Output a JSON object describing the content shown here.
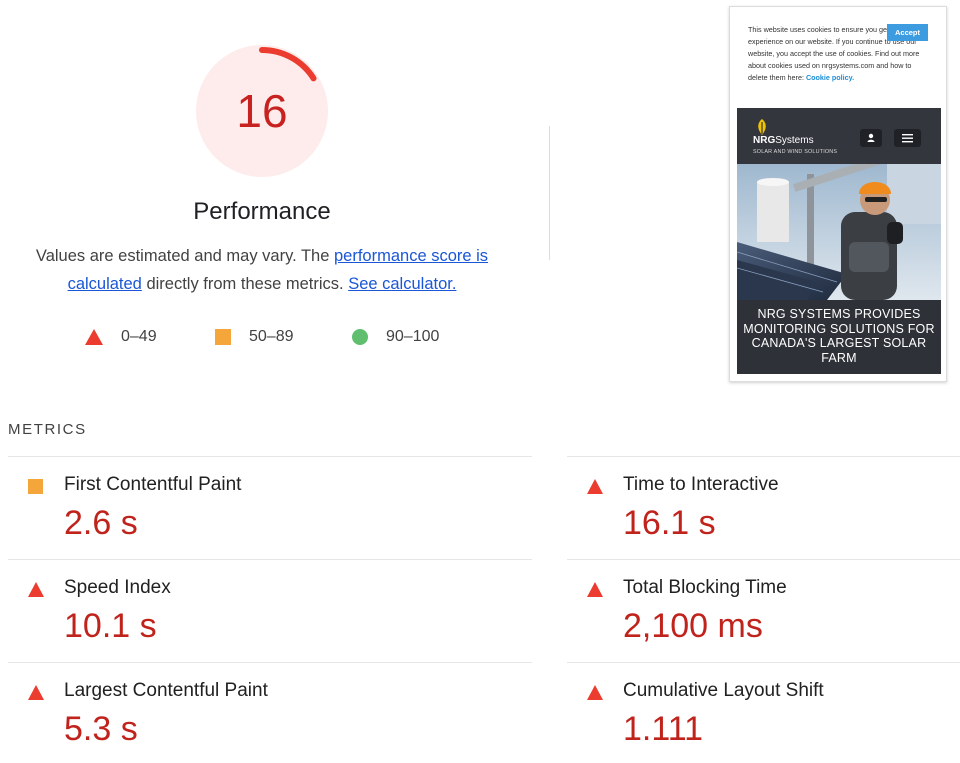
{
  "performance": {
    "score": "16",
    "score_fraction": 0.16,
    "title": "Performance",
    "desc_prefix": "Values are estimated and may vary. The ",
    "link_score": "performance score is calculated",
    "desc_middle": " directly from these metrics. ",
    "link_calculator": "See calculator.",
    "legend": [
      {
        "range": "0–49",
        "icon": "triangle-icon"
      },
      {
        "range": "50–89",
        "icon": "square-icon"
      },
      {
        "range": "90–100",
        "icon": "circle-icon"
      }
    ]
  },
  "screenshot": {
    "cookie_text": "This website uses cookies to ensure you get the best experience on our website. If you continue to use our website, you accept the use of cookies. Find out more about cookies used on nrgsystems.com and how to delete them here: ",
    "cookie_link": "Cookie policy.",
    "accept_label": "Accept",
    "logo_bold": "NRG",
    "logo_rest": "Systems",
    "logo_sub": "SOLAR AND WIND SOLUTIONS",
    "headline": "NRG SYSTEMS PROVIDES MONITORING SOLUTIONS FOR CANADA'S LARGEST SOLAR FARM"
  },
  "metrics": {
    "heading": "METRICS",
    "items": [
      {
        "name": "First Contentful Paint",
        "value": "2.6 s",
        "rating": "average",
        "icon": "square-icon"
      },
      {
        "name": "Time to Interactive",
        "value": "16.1 s",
        "rating": "fail",
        "icon": "triangle-icon"
      },
      {
        "name": "Speed Index",
        "value": "10.1 s",
        "rating": "fail",
        "icon": "triangle-icon"
      },
      {
        "name": "Total Blocking Time",
        "value": "2,100 ms",
        "rating": "fail",
        "icon": "triangle-icon"
      },
      {
        "name": "Largest Contentful Paint",
        "value": "5.3 s",
        "rating": "fail",
        "icon": "triangle-icon"
      },
      {
        "name": "Cumulative Layout Shift",
        "value": "1.111",
        "rating": "fail",
        "icon": "triangle-icon"
      }
    ]
  },
  "colors": {
    "fail": "#eb3c2f",
    "average": "#f4a63a",
    "pass": "#5fbf6f",
    "score_text": "#c7221f",
    "gauge_bg": "#fdeceb",
    "link": "#1a56d6"
  }
}
